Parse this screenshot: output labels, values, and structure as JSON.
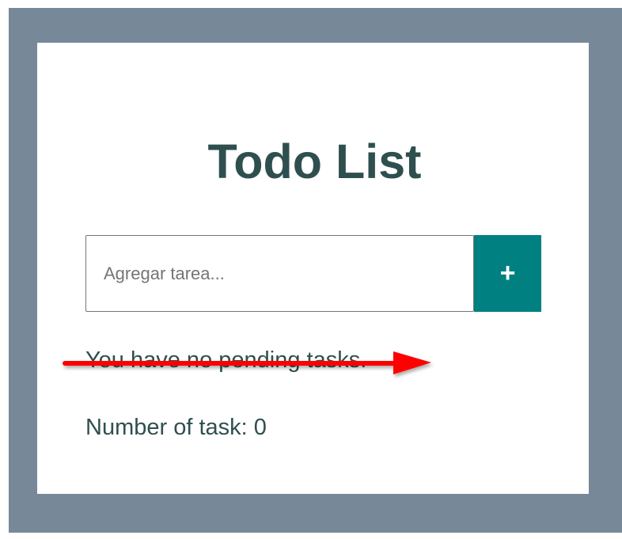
{
  "app": {
    "title": "Todo List"
  },
  "input": {
    "placeholder": "Agregar tarea...",
    "value": ""
  },
  "add_button": {
    "label": "+"
  },
  "status": {
    "pending_message": "You have no pending tasks.",
    "count_text": "Number of task: 0"
  },
  "colors": {
    "page_background": "#778899",
    "card_background": "#ffffff",
    "title": "#2f4f4f",
    "button": "#008080",
    "annotation_arrow": "#ff0000"
  },
  "icons": {
    "annotation": "red-arrow-icon"
  }
}
